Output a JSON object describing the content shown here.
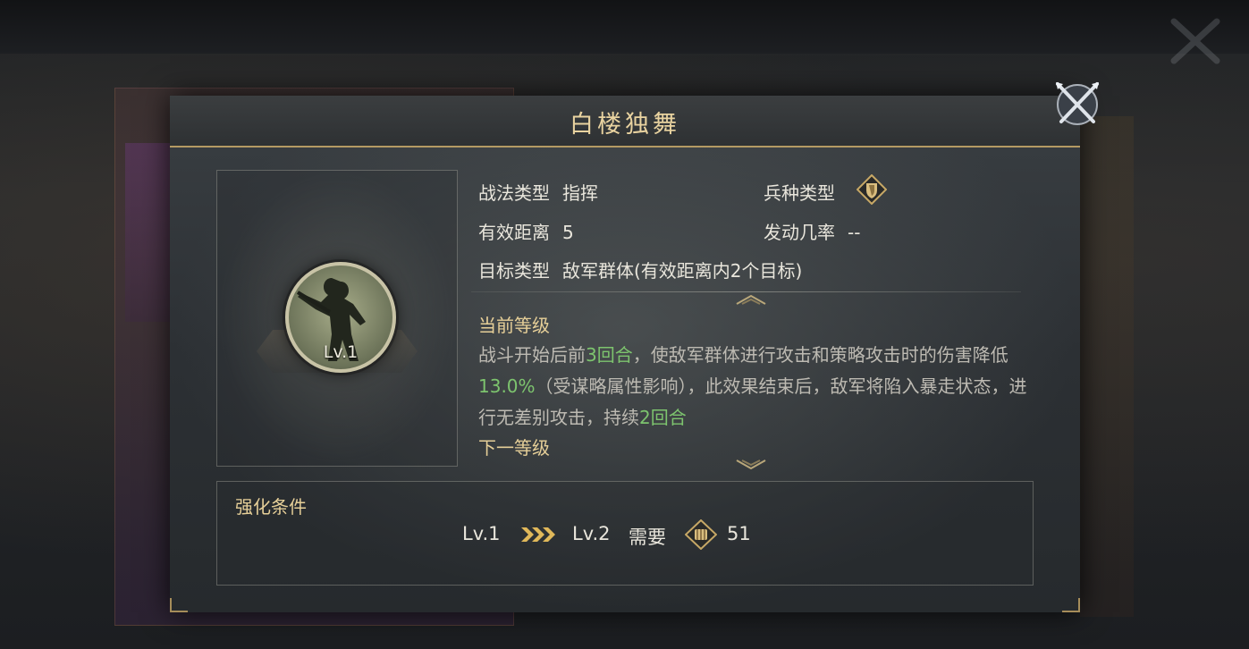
{
  "dialog": {
    "title": "白楼独舞"
  },
  "portrait": {
    "level": "Lv.1"
  },
  "info": {
    "tactic_type_label": "战法类型",
    "tactic_type_value": "指挥",
    "troop_type_label": "兵种类型",
    "troop_type_icon": "shield-icon",
    "range_label": "有效距离",
    "range_value": "5",
    "trigger_label": "发动几率",
    "trigger_value": "--",
    "target_label": "目标类型",
    "target_value": "敌军群体(有效距离内2个目标)"
  },
  "current_level": {
    "heading": "当前等级",
    "desc_1": "战斗开始后前",
    "desc_rounds": "3回合",
    "desc_2": "，使敌军群体进行攻击和策略攻击时的伤害降低",
    "desc_pct": "13.0%",
    "desc_3": "（受谋略属性影响），此效果结束后，敌军将陷入暴走状态，进行无差别攻击，持续",
    "desc_rounds2": "2回合"
  },
  "next_level": {
    "heading": "下一等级"
  },
  "upgrade": {
    "title": "强化条件",
    "from_level": "Lv.1",
    "to_level": "Lv.2",
    "need_label": "需要",
    "cost_icon": "fist-icon",
    "cost_value": "51"
  },
  "colors": {
    "accent_gold": "#e6cf98",
    "highlight_green": "#7dc46e",
    "title_gold": "#e9d3a0"
  }
}
